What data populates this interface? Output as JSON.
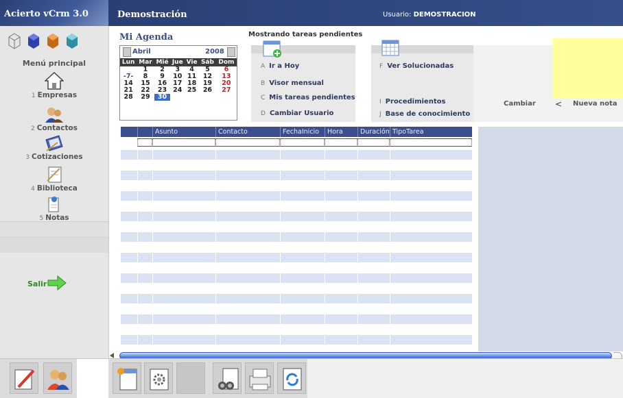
{
  "app": {
    "title": "Acierto vCrm 3.0"
  },
  "header": {
    "section": "Demostración",
    "user_label": "Usuario:",
    "user_name": "DEMOSTRACION"
  },
  "sidebar": {
    "menu_heading": "Menú principal",
    "items": [
      {
        "key": "1",
        "label": "Empresas",
        "icon": "house-icon"
      },
      {
        "key": "2",
        "label": "Contactos",
        "icon": "contacts-icon"
      },
      {
        "key": "3",
        "label": "Cotizaciones",
        "icon": "quote-icon"
      },
      {
        "key": "4",
        "label": "Biblioteca",
        "icon": "library-icon"
      },
      {
        "key": "5",
        "label": "Notas",
        "icon": "note-icon"
      }
    ],
    "logout": "Salir"
  },
  "agenda": {
    "title": "Mi Agenda",
    "showing": "Mostrando tareas pendientes",
    "calendar": {
      "month": "Abril",
      "year": "2008",
      "weekdays": [
        "Lun",
        "Mar",
        "Mié",
        "Jue",
        "Vie",
        "Sáb",
        "Dom"
      ],
      "rows": [
        [
          "",
          "1",
          "2",
          "3",
          "4",
          "5",
          "6"
        ],
        [
          "-7-",
          "8",
          "9",
          "10",
          "11",
          "12",
          "13"
        ],
        [
          "14",
          "15",
          "16",
          "17",
          "18",
          "19",
          "20"
        ],
        [
          "21",
          "22",
          "23",
          "24",
          "25",
          "26",
          "27"
        ],
        [
          "28",
          "29",
          "30",
          "",
          "",
          "",
          ""
        ]
      ],
      "selected": "30"
    },
    "links_left": [
      {
        "key": "A",
        "label": "Ir a Hoy"
      },
      {
        "key": "B",
        "label": "Visor mensual"
      },
      {
        "key": "C",
        "label": "Mis tareas pendientes"
      },
      {
        "key": "D",
        "label": "Cambiar Usuario"
      }
    ],
    "links_right": [
      {
        "key": "F",
        "label": "Ver Solucionadas"
      },
      {
        "key": "I",
        "label": "Procedimientos"
      },
      {
        "key": "J",
        "label": "Base de conocimiento"
      }
    ],
    "cambiar": "Cambiar",
    "nav_prev": "<",
    "new_note": "Nueva nota",
    "note_color": "#ffff9e"
  },
  "task_table": {
    "columns": [
      "",
      "",
      "Asunto",
      "Contacto",
      "FechaInicio",
      "Hora",
      "Duración",
      "TipoTarea"
    ],
    "rows": []
  },
  "colors": {
    "header": "#2b3f73",
    "table_header": "#3b4f8e",
    "row_stripe": "#dbe3f3",
    "logout": "#2e8b22"
  }
}
